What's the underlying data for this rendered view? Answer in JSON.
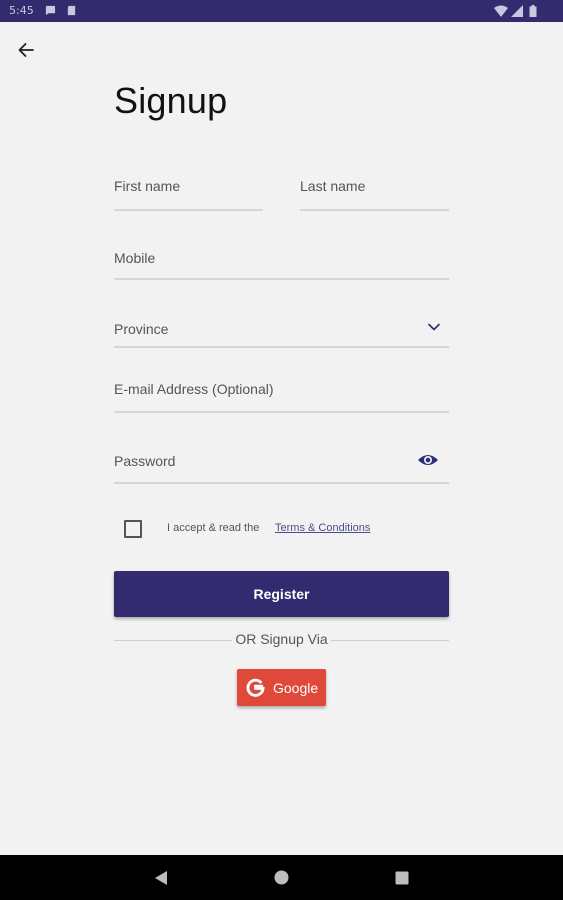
{
  "status_bar": {
    "time": "5:45",
    "icons": [
      "chat-bubble-icon",
      "sd-card-icon",
      "wifi-icon",
      "signal-icon",
      "battery-icon"
    ]
  },
  "header": {
    "back_icon": "arrow-left-icon",
    "title": "Signup"
  },
  "form": {
    "first_name_placeholder": "First name",
    "last_name_placeholder": "Last name",
    "mobile_placeholder": "Mobile",
    "province_placeholder": "Province",
    "email_placeholder": "E-mail Address (Optional)",
    "password_placeholder": "Password",
    "password_toggle_icon": "eye-icon",
    "province_dropdown_icon": "chevron-down-icon"
  },
  "terms": {
    "checked": false,
    "text": "I accept & read the",
    "link_text": "Terms & Conditions"
  },
  "register_label": "Register",
  "or_text": "OR Signup Via",
  "google_label": "Google",
  "colors": {
    "primary": "#322b70",
    "status_bar": "#332b6e",
    "google": "#e0483a",
    "background": "#f2f2f2",
    "accent_icon": "#2b2e7a"
  },
  "nav_bar": {
    "icons": [
      "back-triangle-icon",
      "home-circle-icon",
      "recents-square-icon"
    ]
  }
}
